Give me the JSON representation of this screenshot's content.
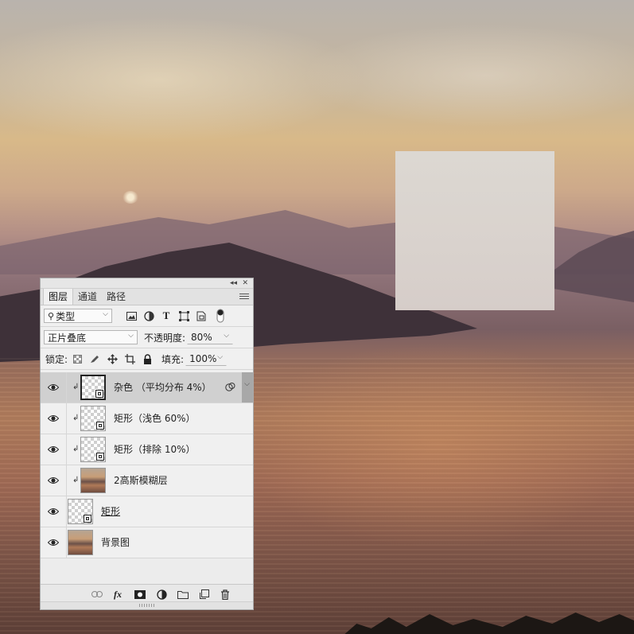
{
  "panel": {
    "tabs": [
      {
        "label": "图层",
        "active": true
      },
      {
        "label": "通道",
        "active": false
      },
      {
        "label": "路径",
        "active": false
      }
    ],
    "filter": {
      "kind_label": "类型"
    },
    "blend_mode": "正片叠底",
    "opacity_label": "不透明度:",
    "opacity_value": "80%",
    "lock_label": "锁定:",
    "fill_label": "填充:",
    "fill_value": "100%",
    "layers": [
      {
        "name": "杂色 （平均分布 4%）",
        "visible": true,
        "clipped": true,
        "selected": true,
        "thumb": "transparent-smart"
      },
      {
        "name": "矩形（浅色 60%）",
        "visible": true,
        "clipped": true,
        "selected": false,
        "thumb": "transparent-smart"
      },
      {
        "name": "矩形（排除 10%）",
        "visible": true,
        "clipped": true,
        "selected": false,
        "thumb": "transparent-smart"
      },
      {
        "name": "2高斯模糊层",
        "visible": true,
        "clipped": true,
        "selected": false,
        "thumb": "photo"
      },
      {
        "name": "矩形",
        "visible": true,
        "clipped": false,
        "selected": false,
        "thumb": "transparent-smart"
      },
      {
        "name": "背景图",
        "visible": true,
        "clipped": false,
        "selected": false,
        "thumb": "photo"
      }
    ],
    "bottom_icons": [
      "link-icon",
      "fx-icon",
      "mask-icon",
      "adjustment-icon",
      "folder-icon",
      "new-layer-icon",
      "trash-icon"
    ],
    "fx_label": "fx"
  },
  "colors": {
    "panel_bg": "#f0f0f0",
    "selected_layer": "#d0d0d0",
    "overlay_rect": "#dad5d0"
  }
}
